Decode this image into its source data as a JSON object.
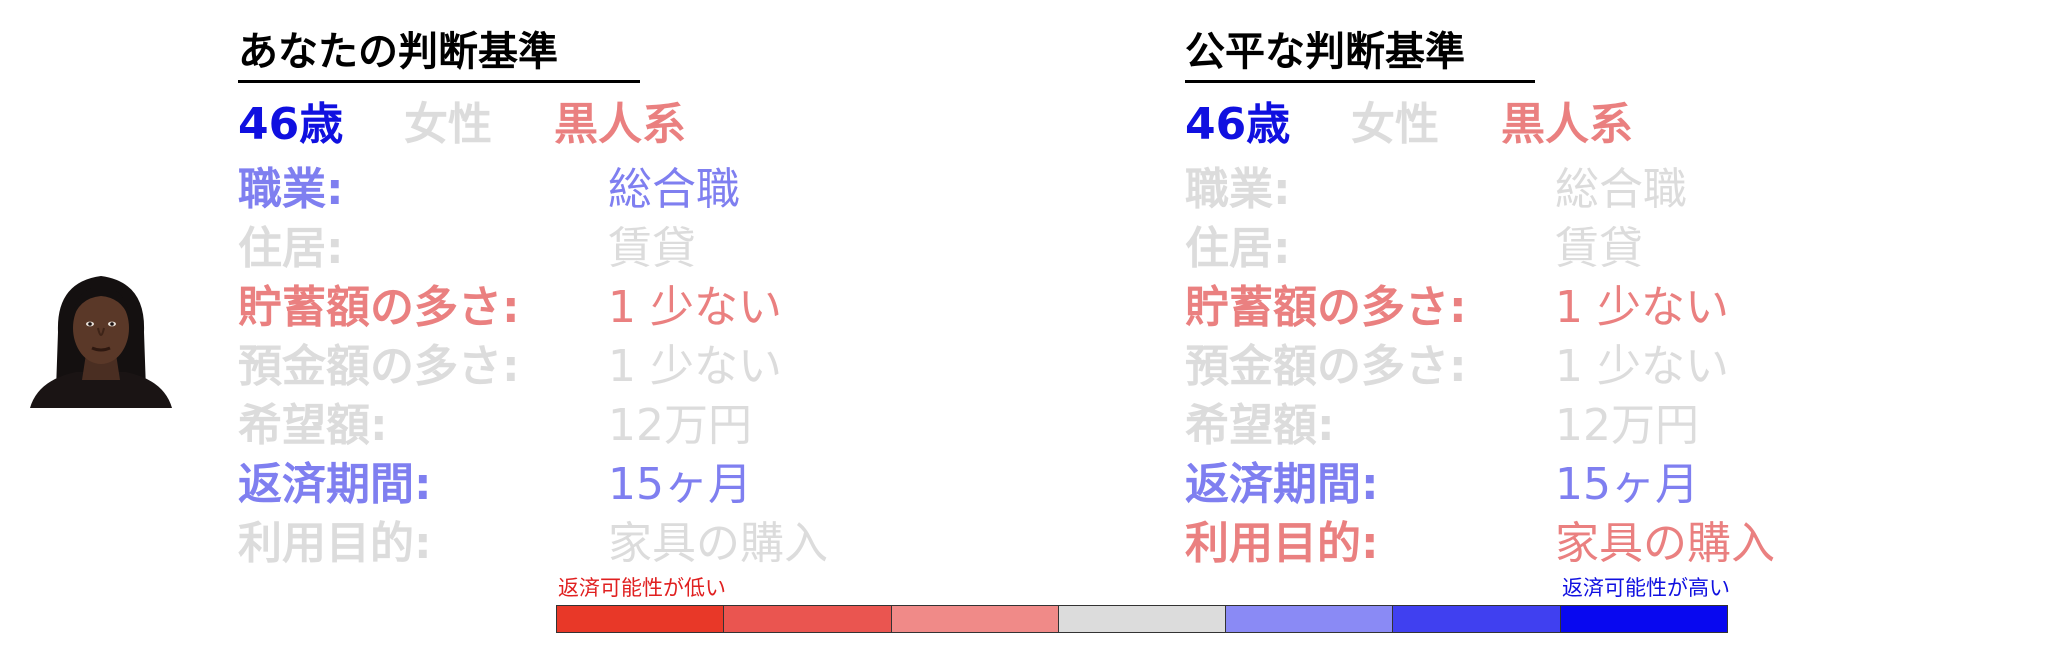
{
  "colors": {
    "strong_blue": "#1010e0",
    "medium_blue": "#7f7ff0",
    "grey": "#dcdcdc",
    "medium_red": "#ea8080",
    "strong_red": "#e02020",
    "black": "#000000"
  },
  "panels": {
    "yours": {
      "title": "あなたの判断基準",
      "demographics": {
        "age": "46歳",
        "age_color": "#1010e0",
        "gender": "女性",
        "gender_color": "#dcdcdc",
        "race": "黒人系",
        "race_color": "#ea8080"
      },
      "attributes": [
        {
          "label": "職業:",
          "value": "総合職",
          "color": "#7f7ff0"
        },
        {
          "label": "住居:",
          "value": "賃貸",
          "color": "#dcdcdc"
        },
        {
          "label": "貯蓄額の多さ:",
          "value": "1 少ない",
          "color": "#ea8080"
        },
        {
          "label": "預金額の多さ:",
          "value": "1 少ない",
          "color": "#dcdcdc"
        },
        {
          "label": "希望額:",
          "value": "12万円",
          "color": "#dcdcdc"
        },
        {
          "label": "返済期間:",
          "value": "15ヶ月",
          "color": "#7f7ff0"
        },
        {
          "label": "利用目的:",
          "value": "家具の購入",
          "color": "#dcdcdc"
        }
      ]
    },
    "fair": {
      "title": "公平な判断基準",
      "demographics": {
        "age": "46歳",
        "age_color": "#1010e0",
        "gender": "女性",
        "gender_color": "#dcdcdc",
        "race": "黒人系",
        "race_color": "#ea8080"
      },
      "attributes": [
        {
          "label": "職業:",
          "value": "総合職",
          "color": "#dcdcdc"
        },
        {
          "label": "住居:",
          "value": "賃貸",
          "color": "#dcdcdc"
        },
        {
          "label": "貯蓄額の多さ:",
          "value": "1 少ない",
          "color": "#ea8080"
        },
        {
          "label": "預金額の多さ:",
          "value": "1 少ない",
          "color": "#dcdcdc"
        },
        {
          "label": "希望額:",
          "value": "12万円",
          "color": "#dcdcdc"
        },
        {
          "label": "返済期間:",
          "value": "15ヶ月",
          "color": "#7f7ff0"
        },
        {
          "label": "利用目的:",
          "value": "家具の購入",
          "color": "#ea8080"
        }
      ]
    }
  },
  "legend": {
    "low_label": "返済可能性が低い",
    "low_color": "#e02020",
    "high_label": "返済可能性が高い",
    "high_color": "#1010e0",
    "swatches": [
      "#e83828",
      "#ea5550",
      "#f08a88",
      "#dcdcdc",
      "#8a8af5",
      "#4040f0",
      "#0808f0"
    ]
  },
  "avatar": {
    "icon": "person-photo-icon"
  }
}
